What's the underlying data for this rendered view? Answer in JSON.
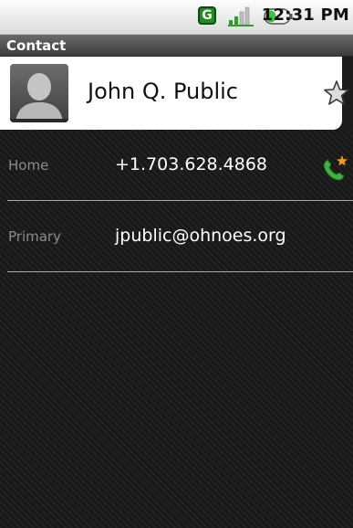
{
  "status_bar": {
    "network_badge": "G",
    "time": "12:31 PM",
    "icons": [
      "network-g-icon",
      "signal-icon",
      "battery-icon"
    ]
  },
  "title_bar": {
    "title": "Contact"
  },
  "contact": {
    "name": "John Q. Public",
    "starred": false
  },
  "details": [
    {
      "label": "Home",
      "value": "+1.703.628.4868",
      "action_icon": "phone-call-icon"
    },
    {
      "label": "Primary",
      "value": "jpublic@ohnoes.org"
    }
  ],
  "colors": {
    "accent_green": "#2e9e2e",
    "battery_green": "#39c83b",
    "label_gray": "#8c8c8c"
  }
}
